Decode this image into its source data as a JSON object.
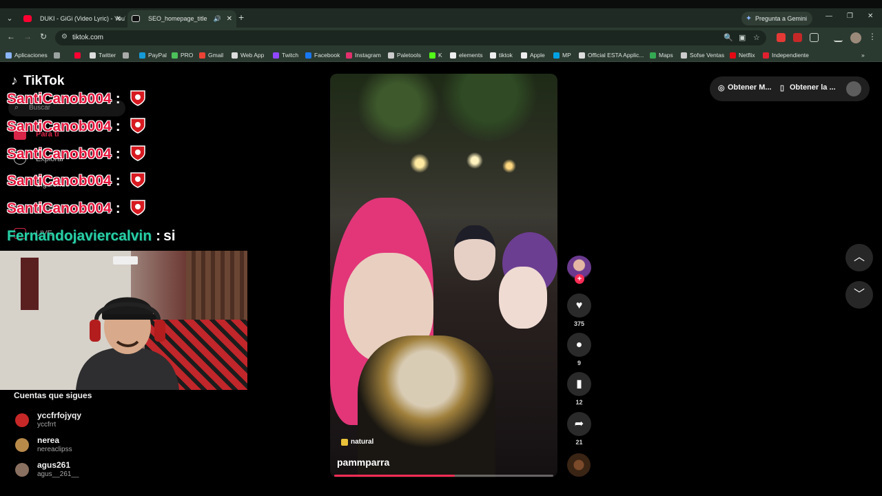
{
  "browser": {
    "tabs": [
      {
        "title": "DUKI - GiGi (Video Lyric) - YouT",
        "favicon_color": "#ff0033"
      },
      {
        "title": "SEO_homepage_title",
        "favicon_color": "#111111"
      }
    ],
    "gemini_label": "Pregunta a Gemini",
    "url": "tiktok.com",
    "bookmarks": [
      {
        "label": "Aplicaciones",
        "color": "#8ab4f8"
      },
      {
        "label": "",
        "color": "#ff0033"
      },
      {
        "label": "Twitter",
        "color": "#dddddd"
      },
      {
        "label": "",
        "color": "#aaaaaa"
      },
      {
        "label": "PayPal",
        "color": "#169bd7"
      },
      {
        "label": "PRO",
        "color": "#4cc05a"
      },
      {
        "label": "Gmail",
        "color": "#ea4335"
      },
      {
        "label": "Web App",
        "color": "#dddddd"
      },
      {
        "label": "Twitch",
        "color": "#9146ff"
      },
      {
        "label": "Facebook",
        "color": "#1877f2"
      },
      {
        "label": "Instagram",
        "color": "#e1306c"
      },
      {
        "label": "Paletools",
        "color": "#cccccc"
      },
      {
        "label": "K",
        "color": "#53fc18"
      },
      {
        "label": "elements",
        "color": "#eeeeee"
      },
      {
        "label": "tiktok",
        "color": "#eeeeee"
      },
      {
        "label": "Apple",
        "color": "#eeeeee"
      },
      {
        "label": "MP",
        "color": "#00a1e4"
      },
      {
        "label": "Official ESTA Applic...",
        "color": "#dddddd"
      },
      {
        "label": "Maps",
        "color": "#34a853"
      },
      {
        "label": "Sofse Ventas",
        "color": "#cccccc"
      },
      {
        "label": "Netflix",
        "color": "#e50914"
      },
      {
        "label": "Independiente",
        "color": "#e0202f"
      }
    ]
  },
  "tiktok": {
    "logo": "TikTok",
    "search_placeholder": "Buscar",
    "nav": [
      "Para ti",
      "Explorar",
      "Siguiendo",
      "Amigos",
      "LIVE"
    ],
    "chat": [
      {
        "user": "SantiCanob004",
        "message": "",
        "badge": true
      },
      {
        "user": "SantiCanob004",
        "message": "",
        "badge": true
      },
      {
        "user": "SantiCanob004",
        "message": "",
        "badge": true
      },
      {
        "user": "SantiCanob004",
        "message": "",
        "badge": true
      },
      {
        "user": "SantiCanob004",
        "message": "",
        "badge": true
      },
      {
        "user": "Fernandojaviercalvin",
        "message": "si",
        "badge": false
      }
    ],
    "following_title": "Cuentas que sigues",
    "following": [
      {
        "name": "yccfrfojyqy",
        "handle": "yccfrrt",
        "avatar_color": "#c62828"
      },
      {
        "name": "nerea",
        "handle": "nereaclipss",
        "avatar_color": "#b88a4a"
      },
      {
        "name": "agus261",
        "handle": "agus__261__",
        "avatar_color": "#8a7060"
      }
    ],
    "video": {
      "tag": "natural",
      "author": "pammparra",
      "progress": 0.55
    },
    "actions": {
      "likes": "375",
      "comments": "9",
      "saves": "12",
      "shares": "21"
    },
    "header_buttons": {
      "get_coins": "Obtener M...",
      "get_app": "Obtener la ..."
    }
  }
}
